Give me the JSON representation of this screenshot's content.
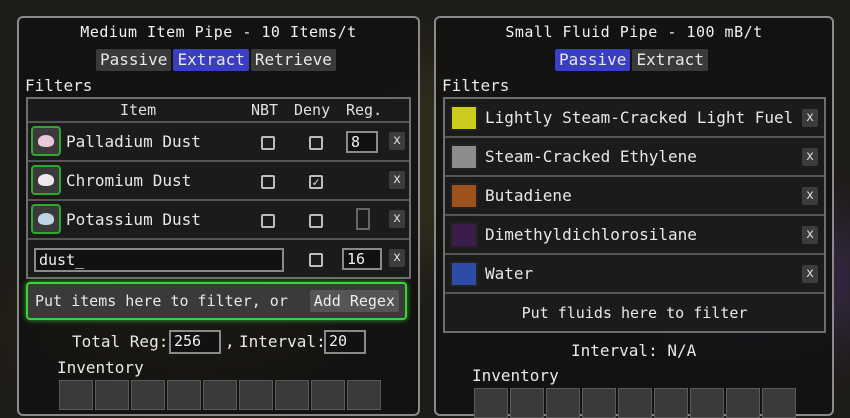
{
  "item_pipe": {
    "title": "Medium Item Pipe - 10 Items/t",
    "modes": [
      {
        "label": "Passive",
        "active": false
      },
      {
        "label": "Extract",
        "active": true
      },
      {
        "label": "Retrieve",
        "active": false
      }
    ],
    "filters_label": "Filters",
    "headers": {
      "item": "Item",
      "nbt": "NBT",
      "deny": "Deny",
      "reg": "Reg."
    },
    "rows": [
      {
        "name": "Palladium Dust",
        "nbt": false,
        "deny": false,
        "reg": "8",
        "dust_color": "#e8c8d8"
      },
      {
        "name": "Chromium Dust",
        "nbt": false,
        "deny": true,
        "reg": "",
        "dust_color": "#f0e8ec"
      },
      {
        "name": "Potassium Dust",
        "nbt": false,
        "deny": false,
        "reg": "",
        "dust_color": "#c0d4e4"
      }
    ],
    "regex_row": {
      "value": "dust_",
      "deny": false,
      "reg": "16"
    },
    "drop_text": "Put items here to filter, or",
    "add_regex_label": "Add Regex",
    "total_reg_label": "Total Reg:",
    "total_reg_value": "256",
    "interval_label": "Interval:",
    "interval_value": "20",
    "inventory_label": "Inventory",
    "remove_glyph": "x",
    "check_glyph": "✓",
    "comma": ","
  },
  "fluid_pipe": {
    "title": "Small Fluid Pipe - 100 mB/t",
    "modes": [
      {
        "label": "Passive",
        "active": true
      },
      {
        "label": "Extract",
        "active": false
      }
    ],
    "filters_label": "Filters",
    "fluids": [
      {
        "name": "Lightly Steam-Cracked Light Fuel",
        "color": "#cccc1e"
      },
      {
        "name": "Steam-Cracked Ethylene",
        "color": "#8c8c8c"
      },
      {
        "name": "Butadiene",
        "color": "#a0521c"
      },
      {
        "name": "Dimethyldichlorosilane",
        "color": "#3c1c4a"
      },
      {
        "name": "Water",
        "color": "#2c4ca8"
      }
    ],
    "drop_text": "Put fluids here to filter",
    "interval_text": "Interval: N/A",
    "inventory_label": "Inventory",
    "remove_glyph": "x"
  }
}
